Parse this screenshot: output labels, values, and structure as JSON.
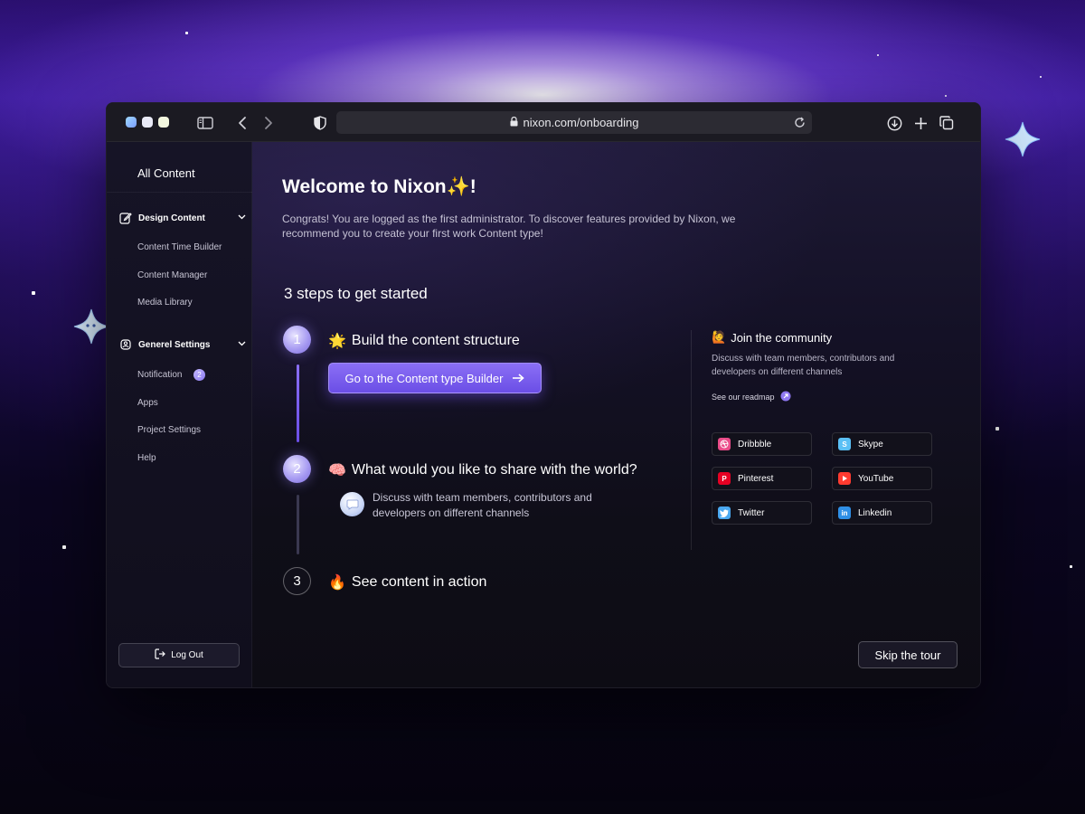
{
  "browser": {
    "url": "nixon.com/onboarding",
    "icons": [
      "sidebar-toggle-icon",
      "back-icon",
      "forward-icon",
      "shield-icon",
      "lock-icon",
      "reload-icon",
      "download-icon",
      "new-tab-icon",
      "tabs-icon"
    ]
  },
  "sidebar": {
    "title": "All Content",
    "groups": [
      {
        "label": "Design Content",
        "icon": "edit-icon",
        "items": [
          "Content Time Builder",
          "Content Manager",
          "Media Library"
        ]
      },
      {
        "label": "Generel Settings",
        "icon": "settings-icon",
        "items": [
          "Notification",
          "Apps",
          "Project Settings",
          "Help"
        ],
        "notification_badge": "2"
      }
    ],
    "logout_label": "Log Out"
  },
  "main": {
    "welcome_title": "Welcome to Nixon✨!",
    "intro": "Congrats! You are logged as the first administrator. To discover features provided by Nixon, we recommend you to create your first work Content type!",
    "steps_title": "3 steps to get started",
    "steps": [
      {
        "number": "1",
        "emoji": "🌟",
        "title": "Build the content structure",
        "state": "done"
      },
      {
        "number": "2",
        "emoji": "🧠",
        "title": "What would you like to share with the world?",
        "state": "active"
      },
      {
        "number": "3",
        "emoji": "🔥",
        "title": "See content in action",
        "state": "pending"
      }
    ],
    "cta_label": "Go to the Content type Builder",
    "share_text": "Discuss with team members, contributors and developers on different channels",
    "skip_label": "Skip the tour"
  },
  "community": {
    "emoji": "🙋",
    "title": "Join the community",
    "description": "Discuss with team members, contributors and developers on different channels",
    "roadmap_label": "See our readmap",
    "channels": [
      {
        "name": "Dribbble",
        "color": "#ea4c89"
      },
      {
        "name": "Skype",
        "color": "#5bc0f5"
      },
      {
        "name": "Pinterest",
        "color": "#e60023"
      },
      {
        "name": "YouTube",
        "color": "#ff3b30"
      },
      {
        "name": "Twitter",
        "color": "#4aa8f0"
      },
      {
        "name": "Linkedin",
        "color": "#2f8fe6"
      }
    ]
  },
  "colors": {
    "accent": "#7b5cf0",
    "window_bg": "#0c0a16",
    "toolbar_bg": "#1b1a22"
  }
}
